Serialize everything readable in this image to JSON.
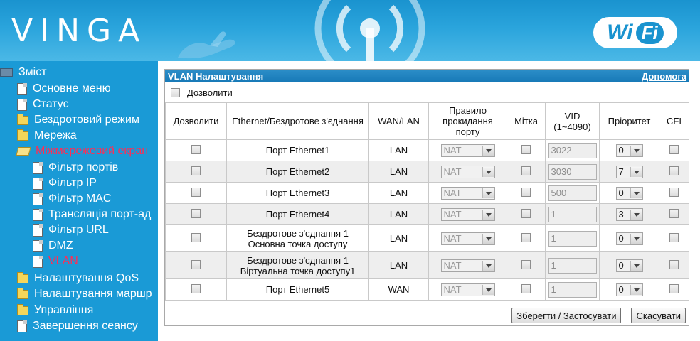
{
  "header": {
    "brand": "VINGA",
    "wifi_wi": "Wi",
    "wifi_fi": "Fi"
  },
  "sidebar": {
    "items": [
      {
        "label": "Зміст",
        "icon": "root-icon"
      },
      {
        "label": "Основне меню",
        "icon": "page-icon"
      },
      {
        "label": "Статус",
        "icon": "page-icon"
      },
      {
        "label": "Бездротовий режим",
        "icon": "folder-icon"
      },
      {
        "label": "Мережа",
        "icon": "folder-icon"
      },
      {
        "label": "Міжмережевий екран",
        "icon": "folder-open-icon"
      },
      {
        "label": "Фільтр портів",
        "icon": "page-icon"
      },
      {
        "label": "Фільтр IP",
        "icon": "page-icon"
      },
      {
        "label": "Фільтр MAC",
        "icon": "page-icon"
      },
      {
        "label": "Трансляція порт-ад",
        "icon": "page-icon"
      },
      {
        "label": "Фільтр URL",
        "icon": "page-icon"
      },
      {
        "label": "DMZ",
        "icon": "page-icon"
      },
      {
        "label": "VLAN",
        "icon": "page-icon"
      },
      {
        "label": "Налаштування QoS",
        "icon": "folder-icon"
      },
      {
        "label": "Налаштування маршр",
        "icon": "folder-icon"
      },
      {
        "label": "Управління",
        "icon": "folder-icon"
      },
      {
        "label": "Завершення сеансу",
        "icon": "page-icon"
      }
    ],
    "active_color": "#ff2d55"
  },
  "panel": {
    "title": "VLAN Налаштування",
    "help_link": "Допомога",
    "enable_label": "Дозволити",
    "columns": [
      "Дозволити",
      "Ethernet/Бездротове з'єднання",
      "WAN/LAN",
      "Правило прокидання порту",
      "Мітка",
      "VID (1~4090)",
      "Пріоритет",
      "CFI"
    ],
    "rows": [
      {
        "connection": "Порт Ethernet1",
        "wanlan": "LAN",
        "rule": "NAT",
        "vid": "3022",
        "priority": "0"
      },
      {
        "connection": "Порт Ethernet2",
        "wanlan": "LAN",
        "rule": "NAT",
        "vid": "3030",
        "priority": "7"
      },
      {
        "connection": "Порт Ethernet3",
        "wanlan": "LAN",
        "rule": "NAT",
        "vid": "500",
        "priority": "0"
      },
      {
        "connection": "Порт Ethernet4",
        "wanlan": "LAN",
        "rule": "NAT",
        "vid": "1",
        "priority": "3"
      },
      {
        "connection": "Бездротове з'єднання 1 Основна точка доступу",
        "wanlan": "LAN",
        "rule": "NAT",
        "vid": "1",
        "priority": "0"
      },
      {
        "connection": "Бездротове з'єднання 1 Віртуальна точка доступу1",
        "wanlan": "LAN",
        "rule": "NAT",
        "vid": "1",
        "priority": "0"
      },
      {
        "connection": "Порт Ethernet5",
        "wanlan": "WAN",
        "rule": "NAT",
        "vid": "1",
        "priority": "0"
      }
    ],
    "save_label": "Зберегти / Застосувати",
    "cancel_label": "Скасувати"
  },
  "colors": {
    "header_blue": "#1a93cf",
    "sidebar_blue": "#1a9ad6",
    "title_bar": "#1779b7"
  }
}
